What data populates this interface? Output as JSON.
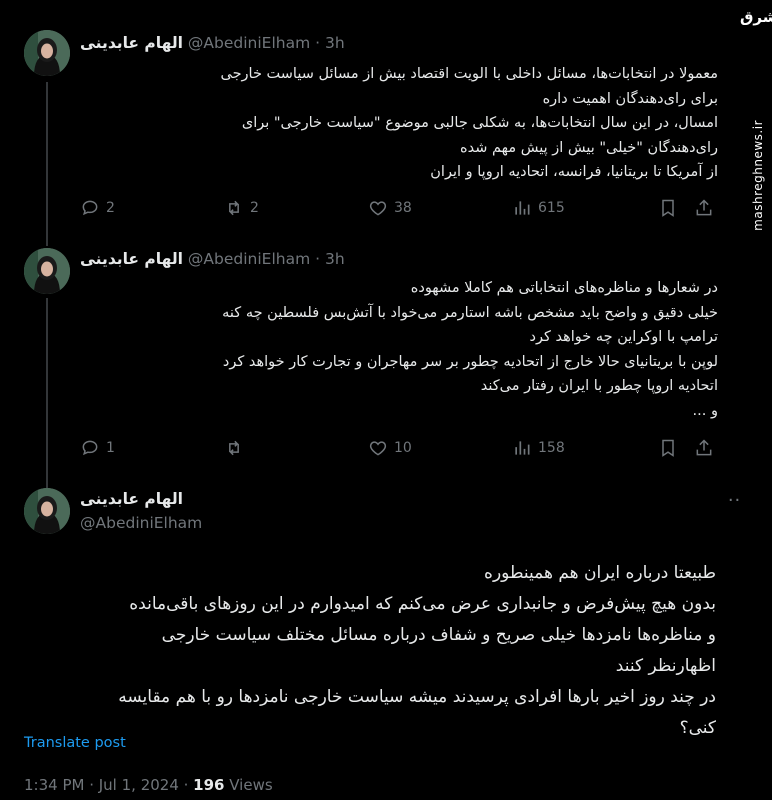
{
  "watermark": {
    "logo": "مشرق",
    "url": "mashreghnews.ir"
  },
  "tweets": [
    {
      "name": "الهام عابدینی",
      "handle": "@AbediniElham",
      "separator": "·",
      "time": "3h",
      "lines": [
        "معمولا در انتخابات‌ها، مسائل داخلی با الویت اقتصاد بیش از مسائل سیاست خارجی",
        "برای رای‌دهندگان اهمیت داره",
        "امسال، در این سال انتخابات‌ها، به شکلی جالبی موضوع \"سیاست خارجی\" برای",
        "رای‌دهندگان \"خیلی\" بیش از پیش مهم شده",
        "از آمریکا تا بریتانیا، فرانسه، اتحادیه اروپا و ایران"
      ],
      "replies": "2",
      "reposts": "2",
      "likes": "38",
      "views": "615"
    },
    {
      "name": "الهام عابدینی",
      "handle": "@AbediniElham",
      "separator": "·",
      "time": "3h",
      "lines": [
        "در شعارها و مناظره‌های انتخاباتی هم کاملا مشهوده",
        "خیلی دقیق و واضح باید مشخص باشه استارمر می‌خواد با آتش‌بس فلسطین چه کنه",
        "ترامپ با اوکراین چه خواهد کرد",
        "لوپن با بریتانیای حالا خارج از اتحادیه چطور بر سر مهاجران و تجارت کار خواهد کرد",
        "اتحادیه اروپا چطور با ایران رفتار می‌کند",
        "و ..."
      ],
      "replies": "1",
      "reposts": "",
      "likes": "10",
      "views": "158"
    }
  ],
  "main_tweet": {
    "name": "الهام عابدینی",
    "handle": "@AbediniElham",
    "more": "···",
    "lines": [
      "طبیعتا درباره ایران هم همینطوره",
      "بدون هیچ پیش‌فرض و جانبداری عرض می‌کنم که امیدوارم در این روزهای باقی‌مانده",
      "و مناظره‌ها نامزدها خیلی صریح و شفاف درباره مسائل مختلف سیاست خارجی",
      "اظهارنظر کنند",
      "در چند روز اخیر بارها افرادی پرسیدند میشه سیاست خارجی نامزدها رو با هم مقایسه",
      "کنی؟"
    ],
    "translate": "Translate post",
    "time": "1:34 PM · Jul 1, 2024 · ",
    "views_count": "196",
    "views_label": " Views"
  },
  "icons": {
    "reply": "reply-icon",
    "repost": "repost-icon",
    "like": "heart-icon",
    "views": "views-bar-chart-icon",
    "bookmark": "bookmark-icon",
    "share": "share-icon"
  }
}
